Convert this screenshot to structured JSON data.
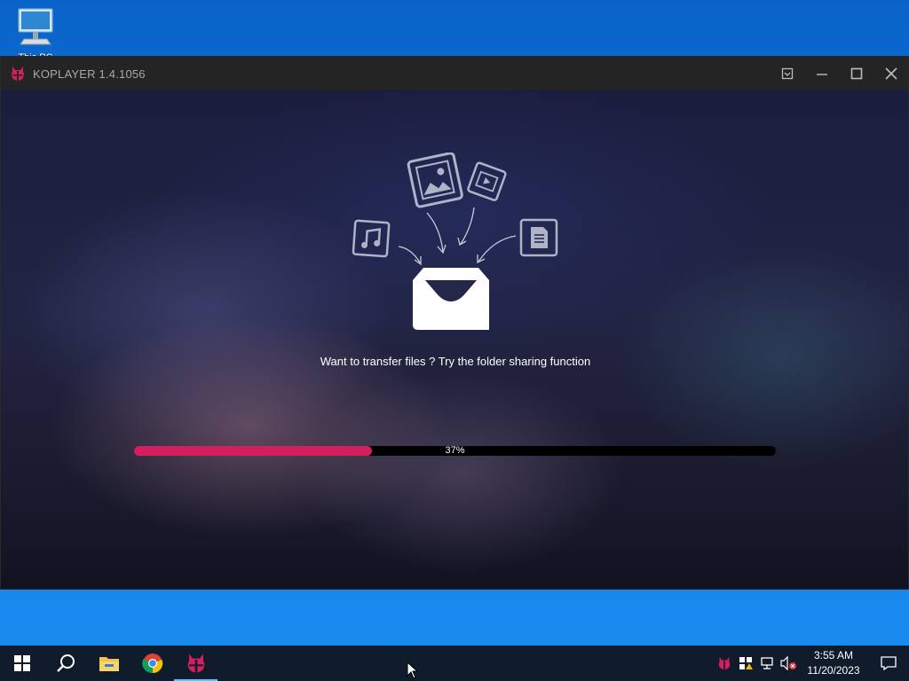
{
  "desktop": {
    "icons": [
      {
        "label": "This PC",
        "icon": "computer-icon"
      }
    ]
  },
  "window": {
    "title": "KOPLAYER 1.4.1056",
    "controls": [
      "restore-down-icon",
      "minimize-icon",
      "maximize-icon",
      "close-icon"
    ]
  },
  "loading": {
    "tip": "Want to transfer files ? Try the folder sharing function",
    "progress_percent": 37,
    "progress_label": "37%",
    "illustration_icons": [
      "music-icon",
      "image-icon",
      "video-icon",
      "document-icon",
      "inbox-icon"
    ]
  },
  "colors": {
    "accent": "#d41f5e",
    "taskbar": "#101b2b",
    "titlebar": "#242424"
  },
  "taskbar": {
    "apps": [
      "start-icon",
      "search-icon",
      "file-explorer-icon",
      "chrome-icon",
      "koplayer-icon"
    ],
    "tray_icons": [
      "koplayer-tray-icon",
      "security-warning-icon",
      "network-icon",
      "volume-muted-icon"
    ],
    "time": "3:55 AM",
    "date": "11/20/2023"
  }
}
